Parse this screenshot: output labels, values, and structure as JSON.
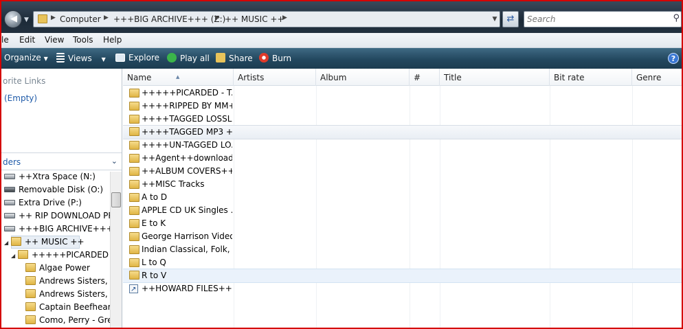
{
  "address": {
    "crumbs": [
      "Computer",
      "+++BIG ARCHIVE+++ (Z:)",
      "++ MUSIC ++"
    ],
    "search_placeholder": "Search"
  },
  "menu": [
    "le",
    "Edit",
    "View",
    "Tools",
    "Help"
  ],
  "toolbar": {
    "organize": "Organize",
    "views": "Views",
    "explore": "Explore",
    "play_all": "Play all",
    "share": "Share",
    "burn": "Burn",
    "help": "?"
  },
  "left_panel": {
    "favorite_links": "orite Links",
    "empty": "(Empty)",
    "folders": "ders"
  },
  "tree": [
    {
      "label": "++Xtra Space (N:)",
      "type": "drive"
    },
    {
      "label": "Removable Disk (O:)",
      "type": "removable"
    },
    {
      "label": "Extra Drive (P:)",
      "type": "drive"
    },
    {
      "label": "++ RIP DOWNLOAD PRO",
      "type": "drive"
    },
    {
      "label": "+++BIG ARCHIVE+++ (Z",
      "type": "drive"
    },
    {
      "label": "++ MUSIC ++",
      "type": "folder"
    },
    {
      "label": "+++++PICARDED - T",
      "type": "folder"
    },
    {
      "label": "Algae Power",
      "type": "folder"
    },
    {
      "label": "Andrews Sisters, Th",
      "type": "folder"
    },
    {
      "label": "Andrews Sisters, Th",
      "type": "folder"
    },
    {
      "label": "Captain Beefheart &",
      "type": "folder"
    },
    {
      "label": "Como, Perry - Grea",
      "type": "folder"
    }
  ],
  "columns": [
    "Name",
    "Artists",
    "Album",
    "#",
    "Title",
    "Bit rate",
    "Genre"
  ],
  "files": [
    {
      "name": "+++++PICARDED - T...",
      "kind": "folder"
    },
    {
      "name": "++++RIPPED BY MM+...",
      "kind": "folder"
    },
    {
      "name": "++++TAGGED LOSSLE...",
      "kind": "folder"
    },
    {
      "name": "++++TAGGED MP3 +...",
      "kind": "folder"
    },
    {
      "name": "++++UN-TAGGED LO...",
      "kind": "folder"
    },
    {
      "name": "++Agent++downloads",
      "kind": "folder"
    },
    {
      "name": "++ALBUM COVERS++",
      "kind": "folder"
    },
    {
      "name": "++MISC Tracks",
      "kind": "folder"
    },
    {
      "name": "A to D",
      "kind": "folder"
    },
    {
      "name": "APPLE CD UK Singles ...",
      "kind": "folder"
    },
    {
      "name": "E to K",
      "kind": "folder"
    },
    {
      "name": "George Harrison Video...",
      "kind": "folder"
    },
    {
      "name": "Indian Classical, Folk, a...",
      "kind": "folder"
    },
    {
      "name": "L to Q",
      "kind": "folder"
    },
    {
      "name": "R to V",
      "kind": "folder"
    },
    {
      "name": "++HOWARD FILES++",
      "kind": "shortcut"
    }
  ],
  "colors": {
    "frame_border": "#d40000",
    "toolbar_bg": "#23485f",
    "link_blue": "#1e5aa8"
  }
}
